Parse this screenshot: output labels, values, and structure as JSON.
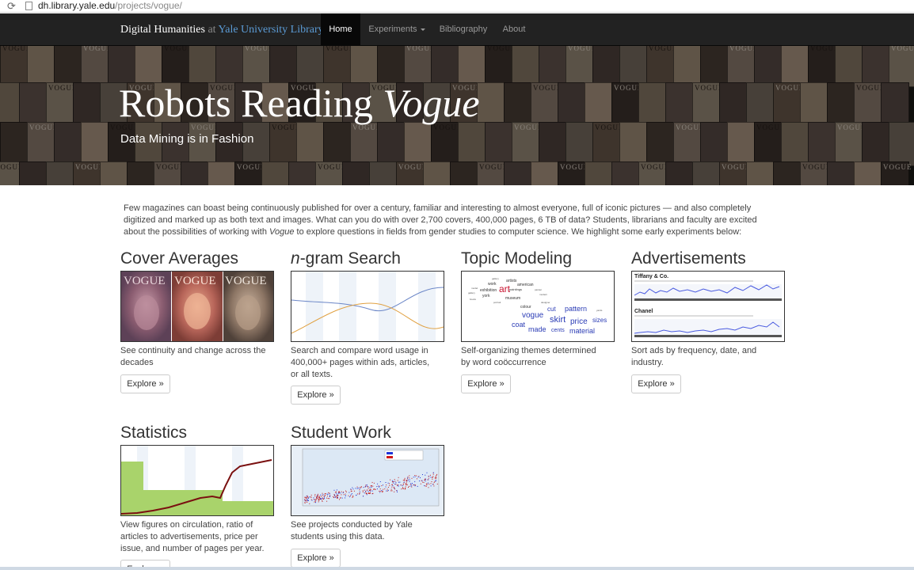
{
  "browser": {
    "reload_glyph": "⟳",
    "url_host": "dh.library.yale.edu",
    "url_path": "/projects/vogue/"
  },
  "navbar": {
    "brand_main": "Digital Humanities",
    "brand_at": "at",
    "brand_yale": "Yale University Library",
    "items": [
      {
        "label": "Home",
        "active": true
      },
      {
        "label": "Experiments",
        "dropdown": true
      },
      {
        "label": "Bibliography"
      },
      {
        "label": "About"
      }
    ]
  },
  "hero": {
    "title_plain": "Robots Reading ",
    "title_italic": "Vogue",
    "subtitle": "Data Mining is in Fashion",
    "cover_word": "VOGUE"
  },
  "intro": {
    "text_1": "Few magazines can boast being continuously published for over a century, familiar and interesting to almost everyone, full of iconic pictures — and also completely digitized and marked up as both text and images. What can you do with over 2,700 covers, 400,000 pages, 6 TB of data? Students, librarians and faculty are excited about the possibilities of working with ",
    "text_italic": "Vogue",
    "text_2": " to explore questions in fields from gender studies to computer science. We highlight some early experiments below:"
  },
  "explore_label": "Explore »",
  "cards": {
    "cover_averages": {
      "title": "Cover Averages",
      "desc": "See continuity and change across the decades"
    },
    "ngram": {
      "title_italic": "n",
      "title_rest": "-gram Search",
      "desc": "Search and compare word usage in 400,000+ pages within ads, articles, or all texts."
    },
    "topic": {
      "title": "Topic Modeling",
      "desc": "Self-organizing themes determined by word coöccurrence"
    },
    "ads": {
      "title": "Advertisements",
      "desc": "Sort ads by frequency, date, and industry.",
      "label_1": "Tiffany & Co.",
      "label_2": "Chanel"
    },
    "stats": {
      "title": "Statistics",
      "desc": "View figures on circulation, ratio of articles to advertisements, price per issue, and number of pages per year."
    },
    "student": {
      "title": "Student Work",
      "desc": "See projects conducted by Yale students using this data."
    }
  },
  "topic_words": [
    "art",
    "vogue",
    "skirt",
    "price",
    "pattern",
    "coat",
    "made",
    "sizes",
    "material",
    "cut",
    "cents",
    "colour",
    "exhibition",
    "paintings",
    "american",
    "artists",
    "museum",
    "york",
    "work"
  ],
  "colors": {
    "navbar_bg": "#222222",
    "brand_link": "#5b9bd5",
    "topic_accent": "#c8102e",
    "topic_blue": "#2a3bb5"
  }
}
